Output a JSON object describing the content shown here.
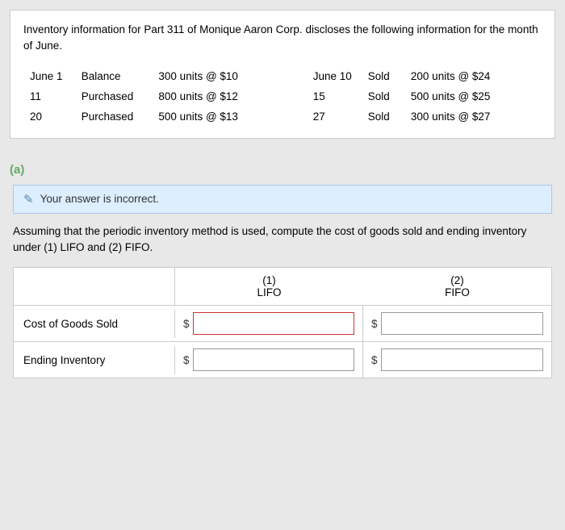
{
  "intro": {
    "text": "Inventory information for Part 311 of Monique Aaron Corp. discloses the following information for the month of June."
  },
  "inventory_rows": [
    {
      "date": "June  1",
      "type": "Balance",
      "detail": "300 units @ $10",
      "date2": "June 10",
      "type2": "Sold",
      "detail2": "200 units @ $24"
    },
    {
      "date": "11",
      "type": "Purchased",
      "detail": "800 units @ $12",
      "date2": "15",
      "type2": "Sold",
      "detail2": "500 units @ $25"
    },
    {
      "date": "20",
      "type": "Purchased",
      "detail": "500 units @ $13",
      "date2": "27",
      "type2": "Sold",
      "detail2": "300 units @ $27"
    }
  ],
  "section_a": {
    "label": "(a)",
    "incorrect_message": "Your answer is incorrect.",
    "question": "Assuming that the periodic inventory method is used, compute the cost of goods sold and ending inventory under (1) LIFO and (2) FIFO.",
    "col1_header_line1": "(1)",
    "col1_header_line2": "LIFO",
    "col2_header_line1": "(2)",
    "col2_header_line2": "FIFO",
    "rows": [
      {
        "label": "Cost of Goods Sold",
        "input1_value": "",
        "input2_value": "",
        "input1_error": true,
        "input2_error": false
      },
      {
        "label": "Ending Inventory",
        "input1_value": "",
        "input2_value": "",
        "input1_error": false,
        "input2_error": false
      }
    ],
    "dollar_sign": "$"
  }
}
